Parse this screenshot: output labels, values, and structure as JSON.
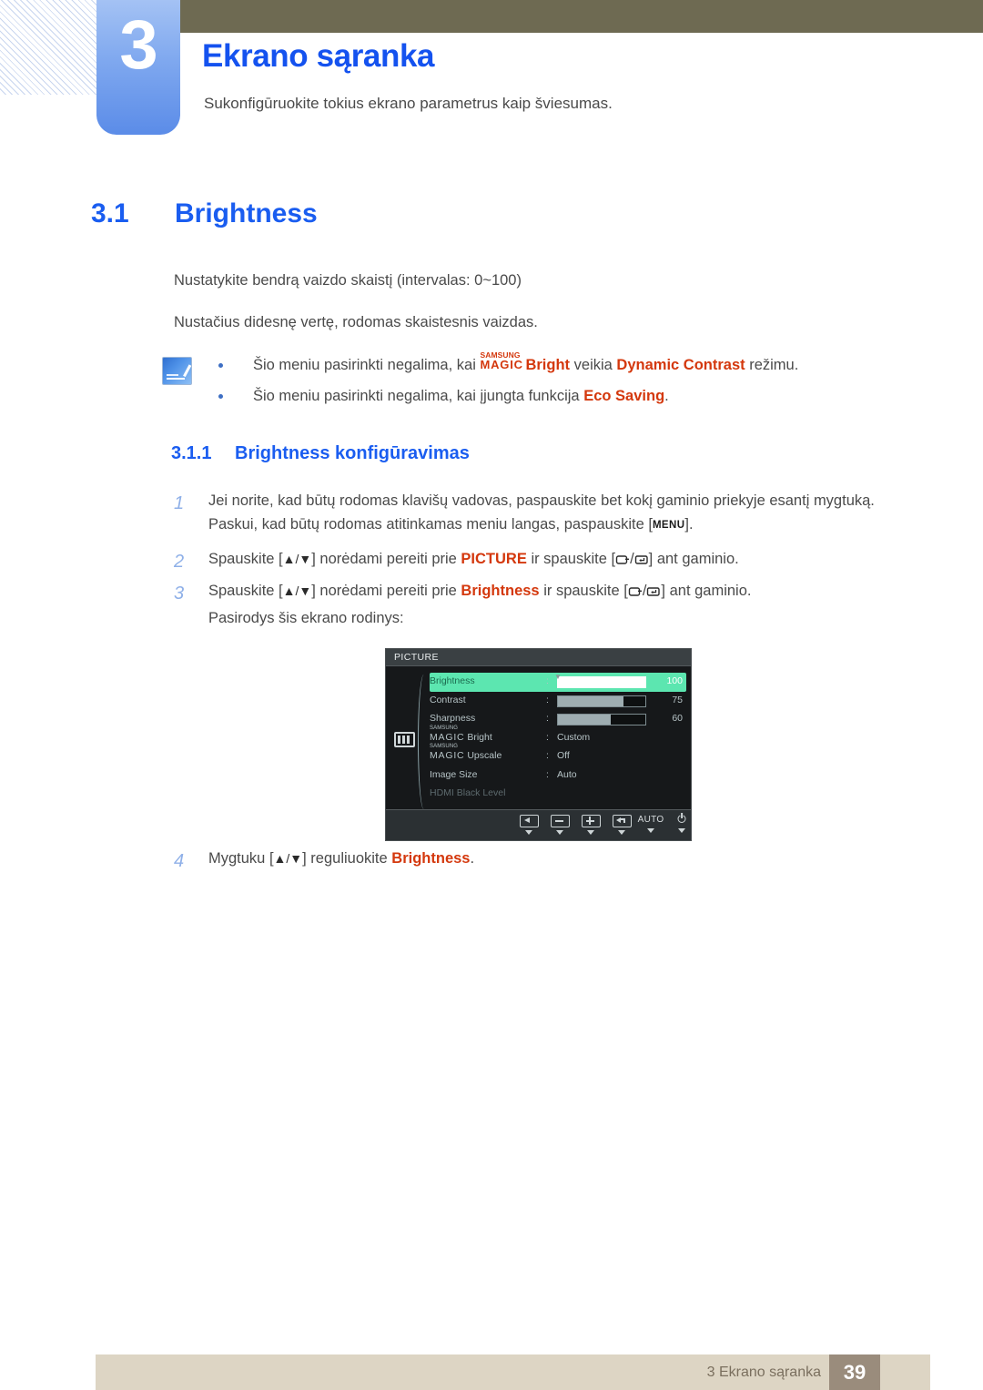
{
  "chapter": {
    "number": "3",
    "title": "Ekrano sąranka",
    "subtitle": "Sukonfigūruokite tokius ekrano parametrus kaip šviesumas."
  },
  "section": {
    "number": "3.1",
    "title": "Brightness"
  },
  "intro": {
    "paragraph_1": "Nustatykite bendrą vaizdo skaistį (intervalas: 0~100)",
    "paragraph_2": "Nustačius didesnę vertę, rodomas skaistesnis vaizdas."
  },
  "note": {
    "icon": "note-pencil-icon",
    "bullets": [
      {
        "text_before": "Šio meniu pasirinkti negalima, kai",
        "brand_samsung": "SAMSUNG",
        "brand_magic": "MAGIC",
        "brand_suffix": "Bright",
        "text_middle": "veikia",
        "highlight": "Dynamic Contrast",
        "text_after": "režimu."
      },
      {
        "text_before": "Šio meniu pasirinkti negalima, kai įjungta funkcija",
        "highlight": "Eco Saving",
        "text_after": "."
      }
    ]
  },
  "subsection": {
    "number": "3.1.1",
    "title": "Brightness konfigūravimas"
  },
  "steps": [
    {
      "index": "1",
      "line_1": "Jei norite, kad būtų rodomas klavišų vadovas, paspauskite bet kokį gaminio priekyje esantį mygtuką.",
      "line_2_before": "Paskui, kad būtų rodomas atitinkamas meniu langas, paspauskite [",
      "line_2_key": "MENU",
      "line_2_after": "]."
    },
    {
      "index": "2",
      "text_1": "Spauskite [",
      "keys": "▲/▼",
      "text_2": "] norėdami pereiti prie",
      "highlight": "PICTURE",
      "text_3": "ir spauskite [",
      "text_4": "] ant gaminio."
    },
    {
      "index": "3",
      "text_1": "Spauskite [",
      "keys": "▲/▼",
      "text_2": "] norėdami pereiti prie",
      "highlight": "Brightness",
      "text_3": "ir spauskite [",
      "text_4": "] ant gaminio."
    },
    {
      "index": "4",
      "text_1": "Mygtuku [",
      "keys": "▲/▼",
      "text_2": "] reguliuokite",
      "highlight": "Brightness",
      "text_3": "."
    }
  ],
  "step3_result": "Pasirodys šis ekrano rodinys:",
  "osd": {
    "title": "PICTURE",
    "sidebar_icon": "picture-menu-icon",
    "scroll_arrow": "▼",
    "rows": [
      {
        "label": "Brightness",
        "colon": ":",
        "value": "100",
        "slider_percent": 100,
        "state": "highlight",
        "kind": "slider"
      },
      {
        "label": "Contrast",
        "colon": ":",
        "value": "75",
        "slider_percent": 75,
        "state": "normal",
        "kind": "slider"
      },
      {
        "label": "Sharpness",
        "colon": ":",
        "value": "60",
        "slider_percent": 60,
        "state": "normal",
        "kind": "slider"
      },
      {
        "label_samsung": "SAMSUNG",
        "label_magic": "MAGIC",
        "label_rest": "Bright",
        "colon": ":",
        "value": "Custom",
        "state": "normal",
        "kind": "magic"
      },
      {
        "label_samsung": "SAMSUNG",
        "label_magic": "MAGIC",
        "label_rest": "Upscale",
        "colon": ":",
        "value": "Off",
        "state": "normal",
        "kind": "magic"
      },
      {
        "label": "Image Size",
        "colon": ":",
        "value": "Auto",
        "state": "normal",
        "kind": "text"
      },
      {
        "label": "HDMI Black Level",
        "colon": "",
        "value": "",
        "state": "dim",
        "kind": "text"
      }
    ],
    "buttons": [
      {
        "name": "back-button",
        "label": ""
      },
      {
        "name": "minus-button",
        "label": ""
      },
      {
        "name": "plus-button",
        "label": ""
      },
      {
        "name": "enter-button",
        "label": ""
      },
      {
        "name": "auto-button",
        "label": "AUTO"
      },
      {
        "name": "power-button",
        "label": ""
      }
    ]
  },
  "footer": {
    "text": "3 Ekrano sąranka",
    "page": "39"
  },
  "colors": {
    "heading_blue": "#1a5df0",
    "chapter_blue": "#1452ef",
    "accent_red": "#d4380d",
    "olive": "#6e6a52",
    "footer_beige": "#ddd5c4",
    "footer_taupe": "#9a8c7c",
    "osd_highlight_green": "#5ce6b0"
  }
}
